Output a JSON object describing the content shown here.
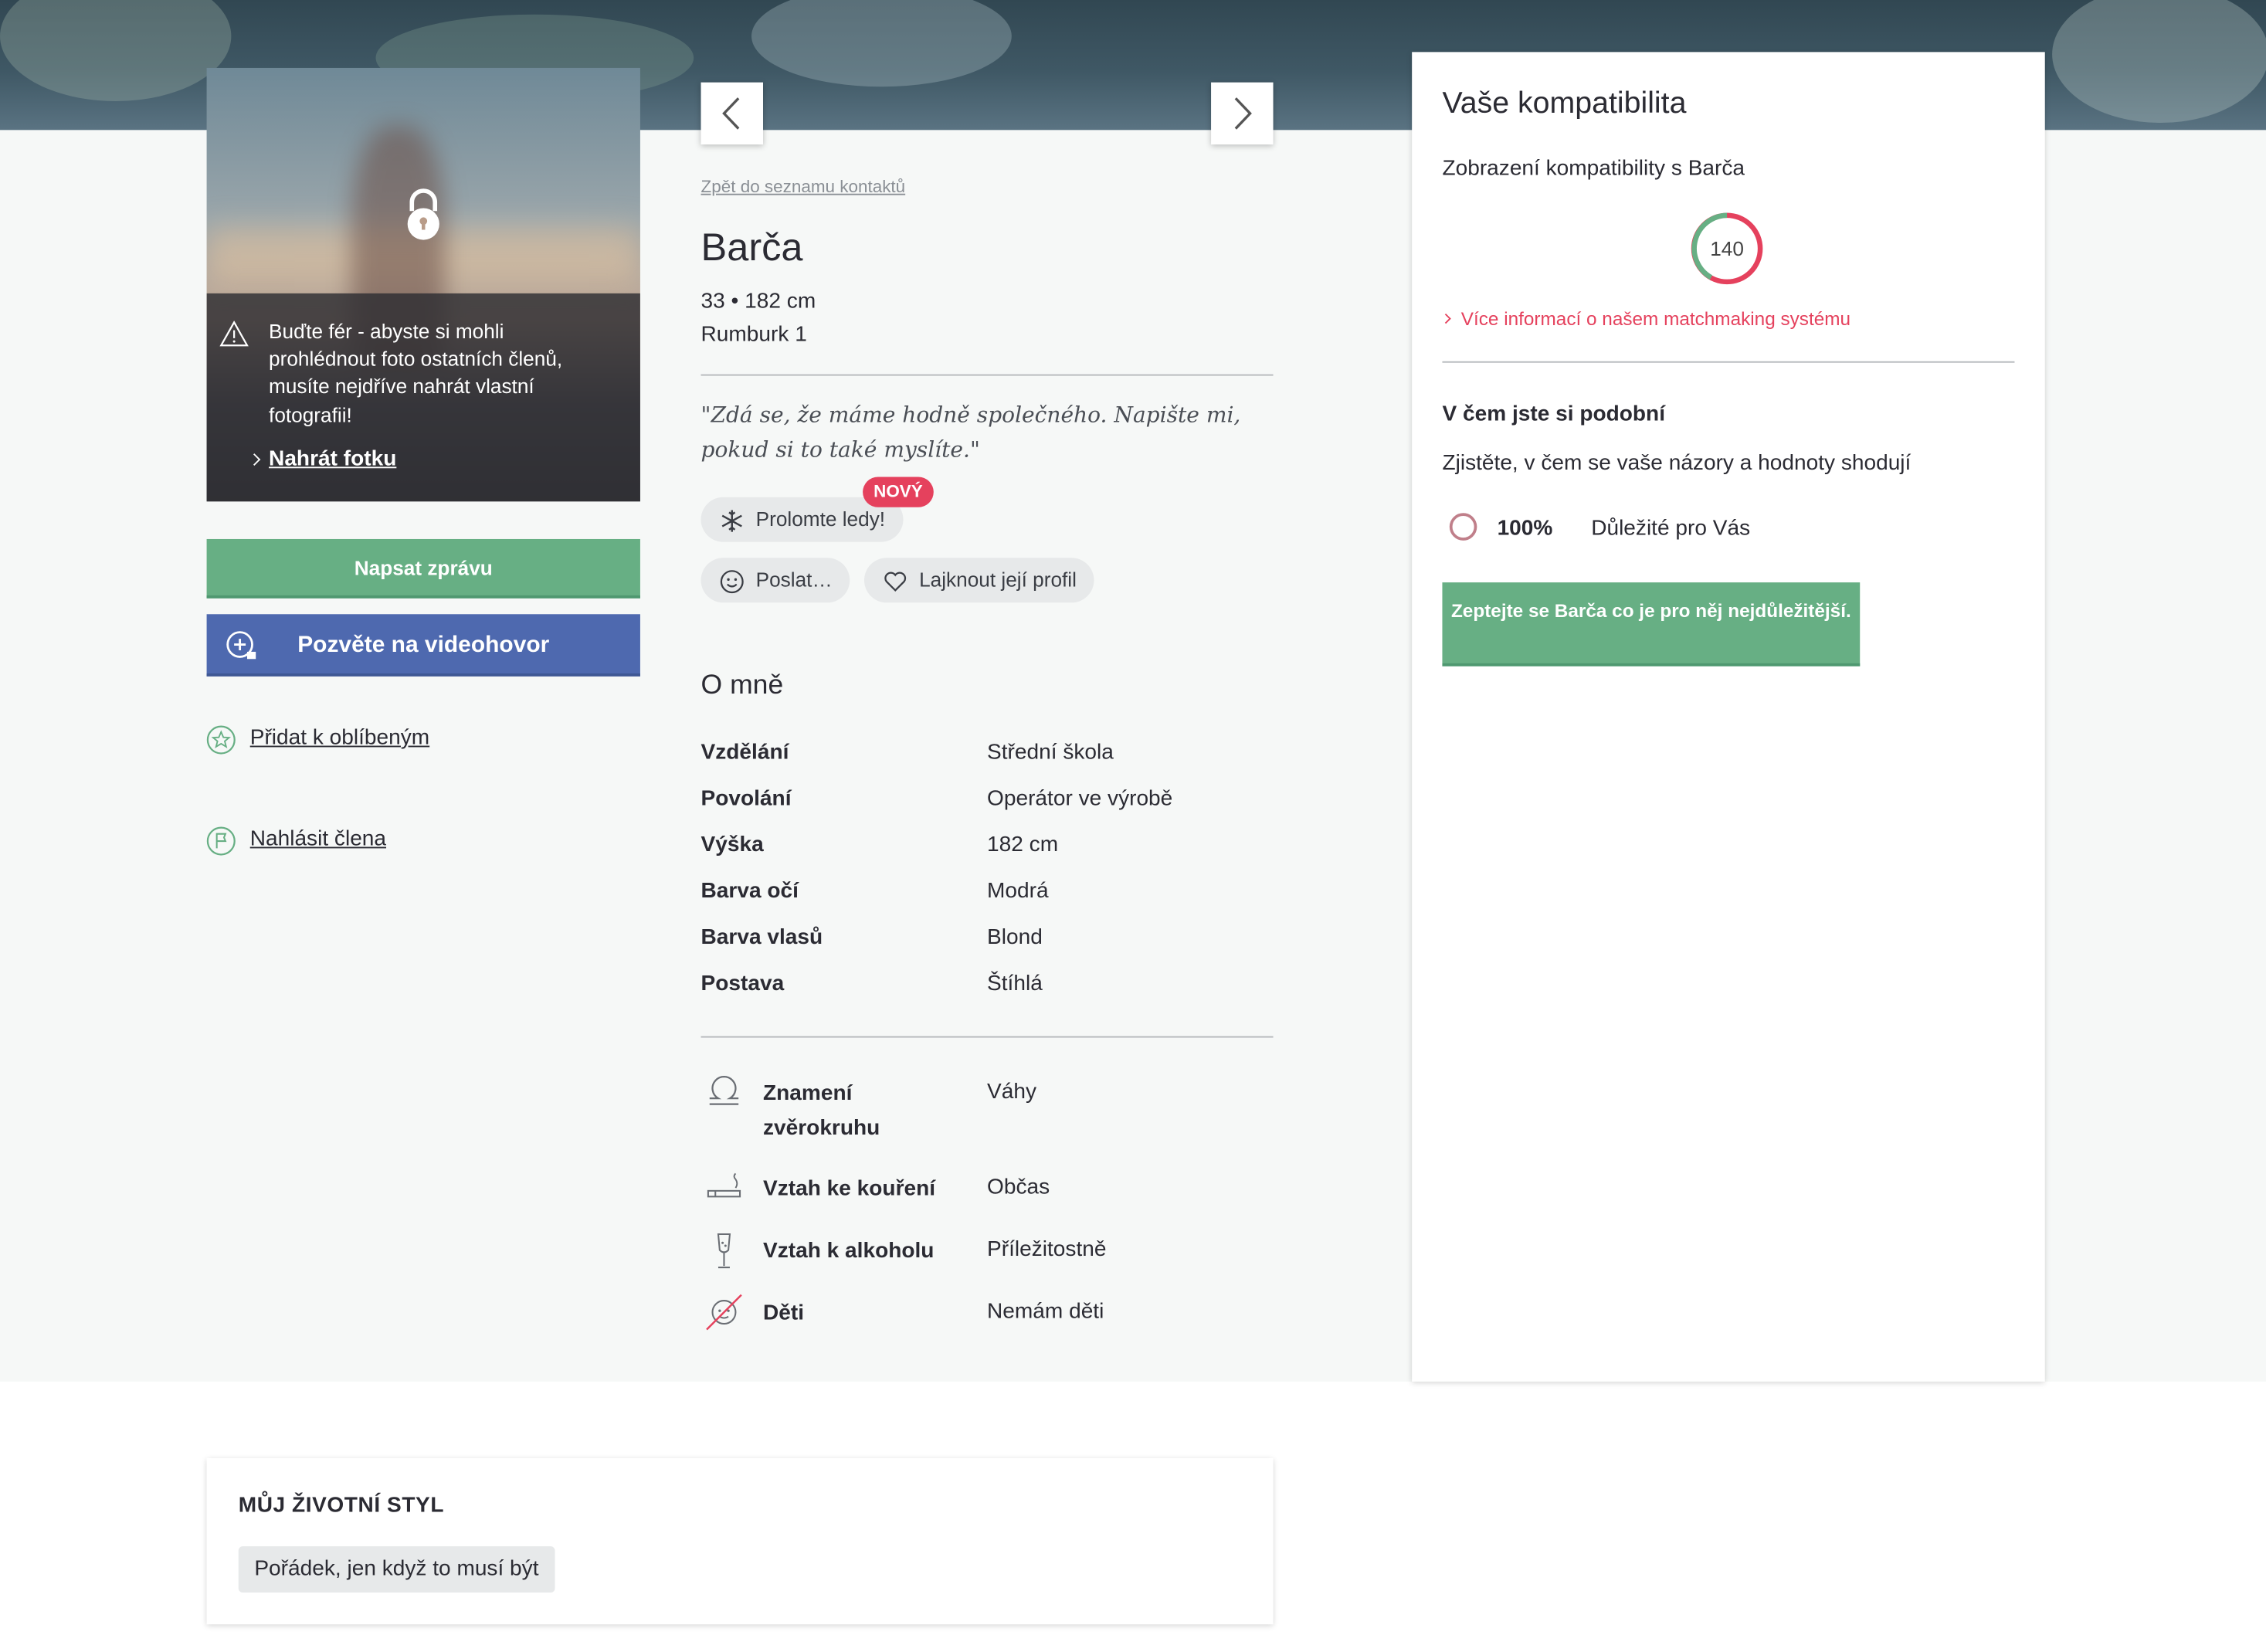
{
  "photo": {
    "warning_text": "Buďte fér - abyste si mohli prohlédnout foto ostatních členů, musíte nejdříve nahrát vlastní fotografii!",
    "upload_link": "Nahrát fotku"
  },
  "actions": {
    "message_button": "Napsat zprávu",
    "video_button": "Pozvěte na videohovor",
    "favorite_link": "Přidat k oblíbeným",
    "report_link": "Nahlásit člena"
  },
  "profile": {
    "back_link": "Zpět do seznamu kontaktů",
    "name": "Barča",
    "age_height": "33 • 182 cm",
    "location": "Rumburk 1",
    "quote": "\"Zdá se, že máme hodně společného. Napište mi, pokud si to také myslíte.\"",
    "icebreaker_label": "Prolomte ledy!",
    "new_badge": "NOVÝ",
    "send_label": "Poslat…",
    "like_label": "Lajknout její profil"
  },
  "about": {
    "title": "O mně",
    "rows": [
      {
        "label": "Vzdělání",
        "value": "Střední škola"
      },
      {
        "label": "Povolání",
        "value": "Operátor ve výrobě"
      },
      {
        "label": "Výška",
        "value": "182 cm"
      },
      {
        "label": "Barva očí",
        "value": "Modrá"
      },
      {
        "label": "Barva vlasů",
        "value": "Blond"
      },
      {
        "label": "Postava",
        "value": "Štíhlá"
      }
    ],
    "icon_rows": [
      {
        "label": "Znamení zvěrokruhu",
        "value": "Váhy",
        "icon": "libra-icon"
      },
      {
        "label": "Vztah ke kouření",
        "value": "Občas",
        "icon": "cigarette-icon"
      },
      {
        "label": "Vztah k alkoholu",
        "value": "Příležitostně",
        "icon": "champagne-glass-icon"
      },
      {
        "label": "Děti",
        "value": "Nemám děti",
        "icon": "no-children-icon"
      }
    ]
  },
  "compatibility": {
    "title": "Vaše kompatibilita",
    "subtitle": "Zobrazení kompatibility s Barča",
    "score": "140",
    "more_info_link": "Více informací o našem matchmaking systému",
    "similar_title": "V čem jste si podobní",
    "similar_subtitle": "Zjistěte, v čem se vaše názory a hodnoty shodují",
    "percent": "100%",
    "important_label": "Důležité pro Vás",
    "ask_button": "Zeptejte se Barča co je pro něj nejdůležitější."
  },
  "lifestyle": {
    "title": "MŮJ ŽIVOTNÍ STYL",
    "tag": "Pořádek, jen když to musí být"
  },
  "colors": {
    "accent_green": "#67af84",
    "accent_blue": "#4e69af",
    "accent_pink": "#e5415d"
  }
}
